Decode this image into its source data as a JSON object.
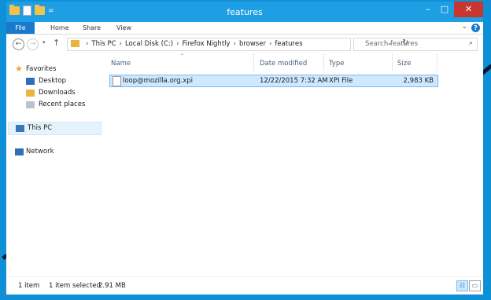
{
  "window": {
    "title": "features"
  },
  "controls": {
    "minimize": "–",
    "maximize": "□",
    "close": "✕"
  },
  "ribbon": {
    "tabs": [
      {
        "label": "File"
      },
      {
        "label": "Home"
      },
      {
        "label": "Share"
      },
      {
        "label": "View"
      }
    ],
    "expand_glyph": "⌄",
    "help_glyph": "?"
  },
  "nav_buttons": {
    "back": "←",
    "forward": "→",
    "recent": "▾",
    "up": "↑"
  },
  "address": {
    "crumbs": [
      "This PC",
      "Local Disk (C:)",
      "Firefox Nightly",
      "browser",
      "features"
    ],
    "separator": "›",
    "dropdown_glyph": "⌄",
    "refresh_glyph": "↻"
  },
  "search": {
    "placeholder": "Search features",
    "icon_glyph": "⌕"
  },
  "navigation": {
    "favorites_label": "Favorites",
    "favorites": [
      {
        "label": "Desktop"
      },
      {
        "label": "Downloads"
      },
      {
        "label": "Recent places"
      }
    ],
    "this_pc_label": "This PC",
    "network_label": "Network"
  },
  "columns": [
    {
      "label": "Name"
    },
    {
      "label": "Date modified"
    },
    {
      "label": "Type"
    },
    {
      "label": "Size"
    }
  ],
  "sort_indicator": "^",
  "files": [
    {
      "name": "loop@mozilla.org.xpi",
      "date_modified": "12/22/2015 7:32 AM",
      "type": "XPI File",
      "size": "2,983 KB"
    }
  ],
  "status": {
    "item_count": "1 item",
    "selection": "1 item selected",
    "selection_size": "2.91 MB"
  },
  "view_buttons": {
    "details": "☷",
    "large_icons": "▭"
  }
}
